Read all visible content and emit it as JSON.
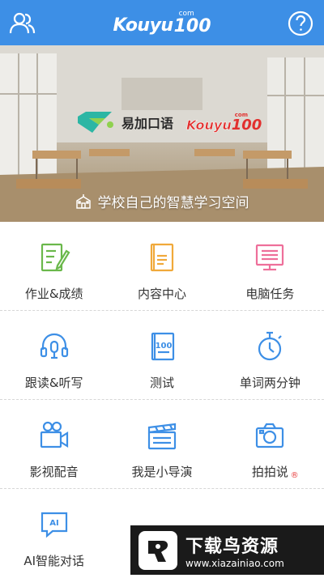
{
  "header": {
    "logo_word": "Kouyu",
    "logo_com": "com",
    "logo_num": "100",
    "left_icon": "user-group-icon",
    "right_icon": "help-icon",
    "bg_color": "#3d8fe6"
  },
  "banner": {
    "brand_cn": "易加口语",
    "brand2_word": "Kouyu",
    "brand2_com": "com",
    "brand2_num": "100",
    "slogan": "学校自己的智慧学习空间"
  },
  "grid": {
    "items": [
      {
        "label": "作业&成绩",
        "icon": "homework-icon",
        "color": "#6ab84b"
      },
      {
        "label": "内容中心",
        "icon": "book-icon",
        "color": "#f0a93a"
      },
      {
        "label": "电脑任务",
        "icon": "computer-icon",
        "color": "#ee6f9a"
      },
      {
        "label": "跟读&听写",
        "icon": "headphone-icon",
        "color": "#3d8fe6"
      },
      {
        "label": "测试",
        "icon": "test-icon",
        "color": "#3d8fe6"
      },
      {
        "label": "单词两分钟",
        "icon": "stopwatch-icon",
        "color": "#3d8fe6"
      },
      {
        "label": "影视配音",
        "icon": "video-camera-icon",
        "color": "#3d8fe6"
      },
      {
        "label": "我是小导演",
        "icon": "clapperboard-icon",
        "color": "#3d8fe6"
      },
      {
        "label": "拍拍说",
        "icon": "camera-icon",
        "color": "#3d8fe6"
      },
      {
        "label": "AI智能对话",
        "icon": "ai-chat-icon",
        "color": "#3d8fe6"
      },
      {
        "label": "",
        "icon": "",
        "color": "#3d8fe6"
      },
      {
        "label": "",
        "icon": "",
        "color": "#3d8fe6"
      }
    ],
    "test_icon_text": "100",
    "ai_icon_text": "AI",
    "registered_mark": "®"
  },
  "watermark": {
    "title": "下载鸟资源",
    "url": "www.xiazainiao.com"
  }
}
